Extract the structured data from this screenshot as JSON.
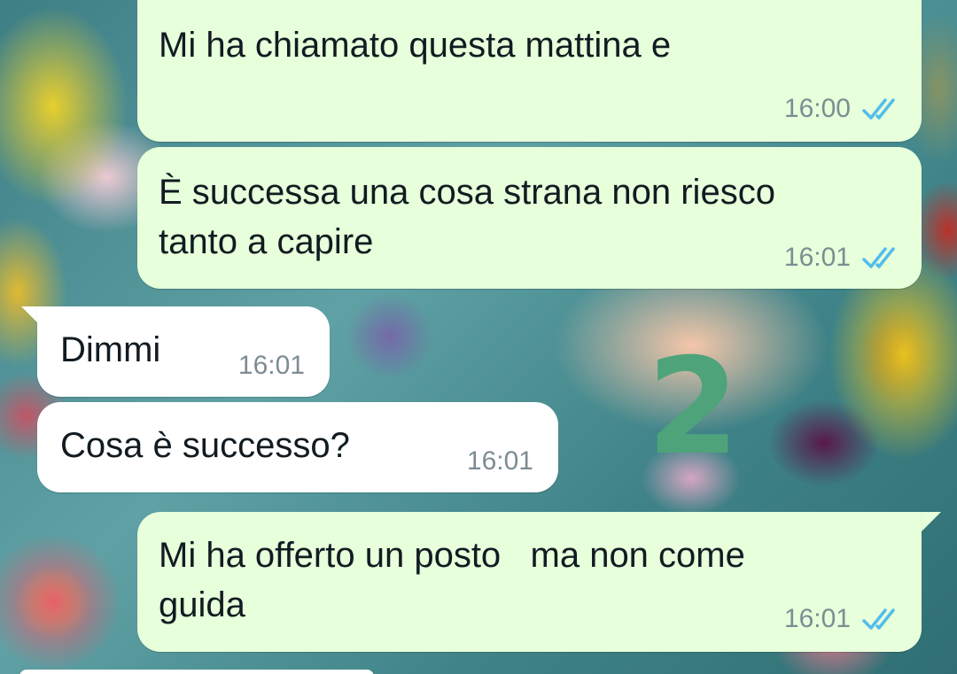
{
  "chat": {
    "messages": [
      {
        "direction": "outgoing",
        "text": "Mi ha chiamato questa mattina e",
        "time": "16:00",
        "status": "read",
        "status_icon": "double-check-icon"
      },
      {
        "direction": "outgoing",
        "lines": [
          "È successa una cosa strana non riesco",
          "tanto a capire"
        ],
        "time": "16:01",
        "status": "read",
        "status_icon": "double-check-icon"
      },
      {
        "direction": "incoming",
        "text": "Dimmi",
        "time": "16:01"
      },
      {
        "direction": "incoming",
        "text": "Cosa è successo?",
        "time": "16:01"
      },
      {
        "direction": "outgoing",
        "lines": [
          "Mi ha offerto un posto   ma non come",
          "guida"
        ],
        "time": "16:01",
        "status": "read",
        "status_icon": "double-check-icon"
      }
    ]
  },
  "annotation": {
    "text": "2",
    "color": "#4fa37a"
  },
  "colors": {
    "outgoing_bubble": "#e7ffdb",
    "incoming_bubble": "#ffffff",
    "read_ticks": "#53bdeb",
    "timestamp": "#7e8c93"
  }
}
